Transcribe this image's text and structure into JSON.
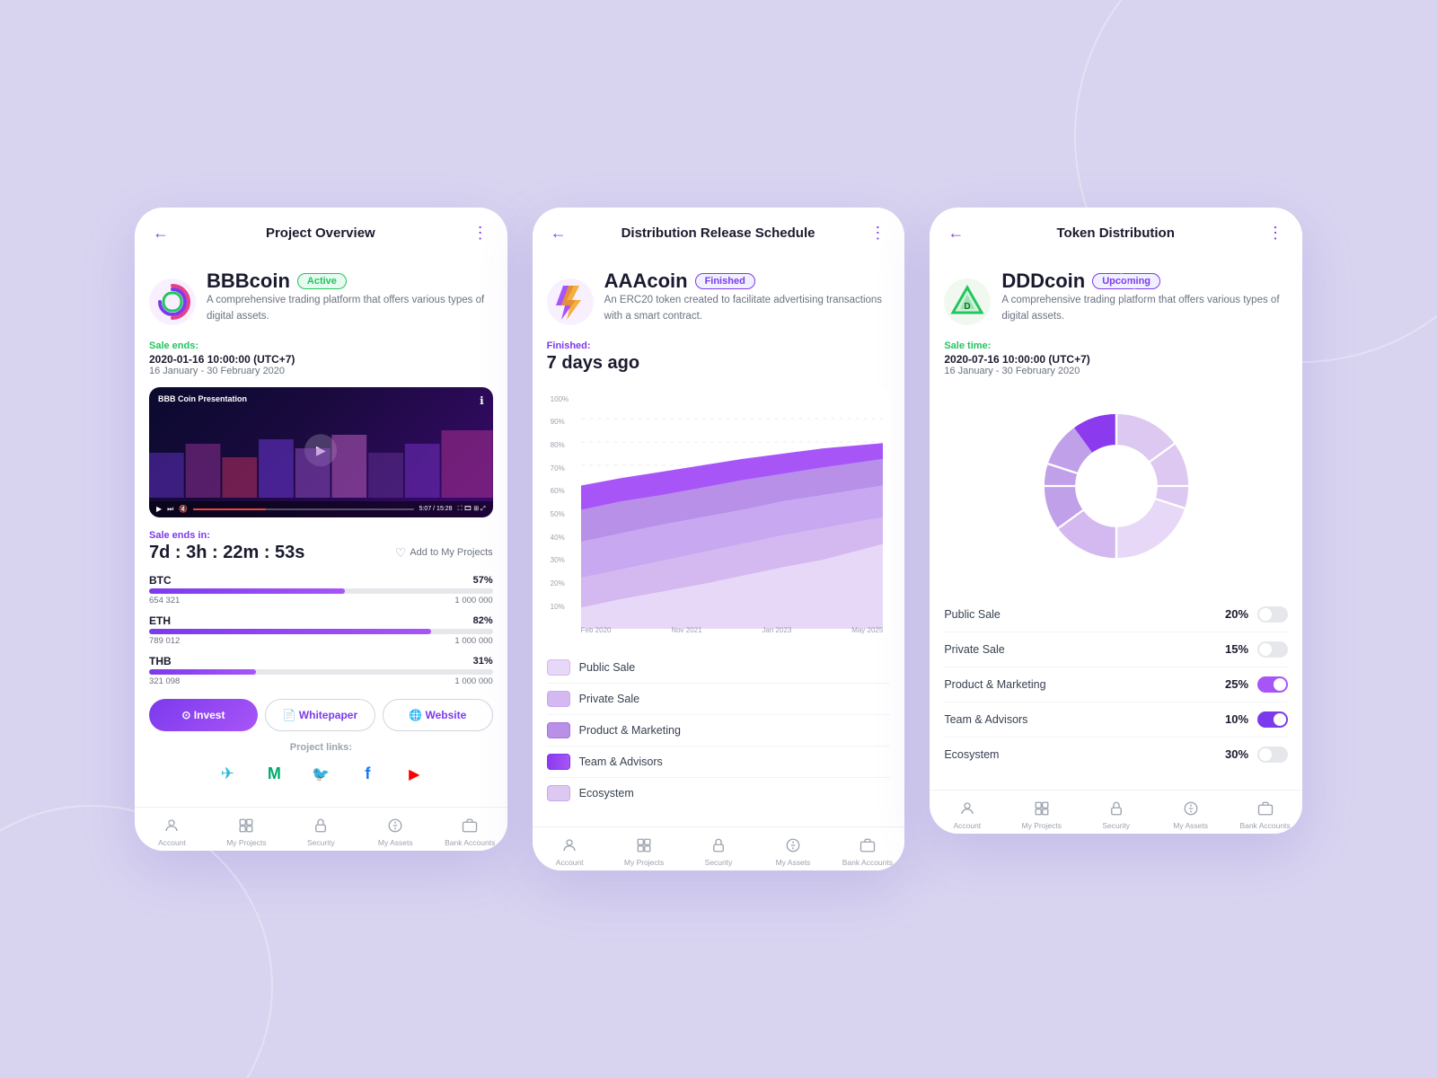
{
  "background_color": "#d8d4f0",
  "phones": [
    {
      "id": "phone1",
      "header": {
        "title": "Project Overview",
        "back_icon": "←",
        "menu_icon": "⋮"
      },
      "coin": {
        "name": "BBBcoin",
        "badge": "Active",
        "badge_type": "active",
        "description": "A comprehensive trading platform that offers various types of digital assets.",
        "sale_label": "Sale ends:",
        "sale_date": "2020-01-16 10:00:00 (UTC+7)",
        "sale_range": "16 January - 30 February 2020"
      },
      "video": {
        "label": "BBB Coin Presentation",
        "time_current": "5:07",
        "time_total": "15:28",
        "progress_pct": 33
      },
      "countdown": {
        "label": "Sale ends in:",
        "value": "7d : 3h : 22m : 53s"
      },
      "add_to_projects_label": "Add to My Projects",
      "progress_bars": [
        {
          "currency": "BTC",
          "pct": 57,
          "current": "654 321",
          "total": "1 000 000"
        },
        {
          "currency": "ETH",
          "pct": 82,
          "current": "789 012",
          "total": "1 000 000"
        },
        {
          "currency": "THB",
          "pct": 31,
          "current": "321 098",
          "total": "1 000 000"
        }
      ],
      "buttons": [
        {
          "label": "Invest",
          "type": "invest",
          "icon": "⊙"
        },
        {
          "label": "Whitepaper",
          "type": "outline",
          "icon": "📄"
        },
        {
          "label": "Website",
          "type": "outline",
          "icon": "🌐"
        }
      ],
      "links_label": "Project links:",
      "social_icons": [
        {
          "name": "telegram",
          "color": "#29b6d8",
          "symbol": "✈"
        },
        {
          "name": "medium",
          "color": "#00ab6c",
          "symbol": "M"
        },
        {
          "name": "twitter",
          "color": "#1da1f2",
          "symbol": "🐦"
        },
        {
          "name": "facebook",
          "color": "#1877f2",
          "symbol": "f"
        },
        {
          "name": "youtube",
          "color": "#ff0000",
          "symbol": "▶"
        }
      ],
      "nav": [
        {
          "label": "Account",
          "icon": "👤"
        },
        {
          "label": "My Projects",
          "icon": "📁"
        },
        {
          "label": "Security",
          "icon": "🔒"
        },
        {
          "label": "My Assets",
          "icon": "💰"
        },
        {
          "label": "Bank Accounts",
          "icon": "🏦"
        }
      ]
    },
    {
      "id": "phone2",
      "header": {
        "title": "Distribution Release Schedule",
        "back_icon": "←",
        "menu_icon": "⋮"
      },
      "coin": {
        "name": "AAAcoin",
        "badge": "Finished",
        "badge_type": "finished",
        "description": "An ERC20 token created to facilitate advertising transactions with a smart contract."
      },
      "finished": {
        "label": "Finished:",
        "value": "7 days ago"
      },
      "chart": {
        "y_labels": [
          "10%",
          "20%",
          "30%",
          "40%",
          "50%",
          "60%",
          "70%",
          "80%",
          "90%",
          "100%"
        ],
        "x_labels": [
          "Feb 2020",
          "Nov 2021",
          "Jan 2023",
          "May 2025"
        ]
      },
      "legend": [
        {
          "label": "Public Sale",
          "color": "#e8d8f8"
        },
        {
          "label": "Private Sale",
          "color": "#d4b8f0"
        },
        {
          "label": "Product & Marketing",
          "color": "#b890e8"
        },
        {
          "label": "Team & Advisors",
          "color": "#7c3aed"
        },
        {
          "label": "Ecosystem",
          "color": "#c8a8f0"
        }
      ],
      "nav": [
        {
          "label": "Account",
          "icon": "👤"
        },
        {
          "label": "My Projects",
          "icon": "📁"
        },
        {
          "label": "Security",
          "icon": "🔒"
        },
        {
          "label": "My Assets",
          "icon": "💰"
        },
        {
          "label": "Bank Accounts",
          "icon": "🏦"
        }
      ]
    },
    {
      "id": "phone3",
      "header": {
        "title": "Token Distribution",
        "back_icon": "←",
        "menu_icon": "⋮"
      },
      "coin": {
        "name": "DDDcoin",
        "badge": "Upcoming",
        "badge_type": "upcoming",
        "description": "A comprehensive trading platform that offers various types of digital assets.",
        "sale_label": "Sale time:",
        "sale_date": "2020-07-16 10:00:00 (UTC+7)",
        "sale_range": "16 January - 30 February 2020"
      },
      "donut": {
        "segments": [
          {
            "label": "Public Sale",
            "pct": 20,
            "color": "#e8d8f8",
            "toggle": false
          },
          {
            "label": "Private Sale",
            "pct": 15,
            "color": "#d4b8f0",
            "toggle": false
          },
          {
            "label": "Product & Marketing",
            "pct": 25,
            "color": "#b890e8",
            "toggle": true
          },
          {
            "label": "Team & Advisors",
            "pct": 10,
            "color": "#7c3aed",
            "toggle": true
          },
          {
            "label": "Ecosystem",
            "pct": 30,
            "color": "#c8a8f0",
            "toggle": false
          }
        ]
      },
      "nav": [
        {
          "label": "Account",
          "icon": "👤"
        },
        {
          "label": "My Projects",
          "icon": "📁"
        },
        {
          "label": "Security",
          "icon": "🔒"
        },
        {
          "label": "My Assets",
          "icon": "💰"
        },
        {
          "label": "Bank Accounts",
          "icon": "🏦"
        }
      ]
    }
  ]
}
